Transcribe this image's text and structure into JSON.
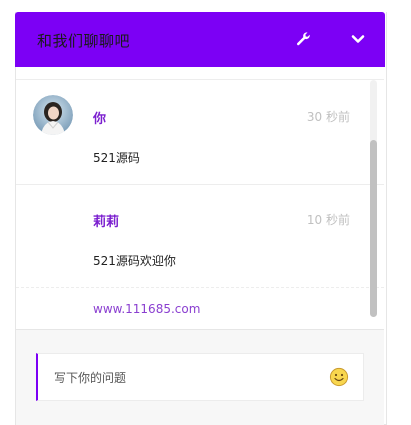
{
  "header": {
    "title": "和我们聊聊吧",
    "settings_icon": "wrench-icon",
    "collapse_icon": "chevron-down-icon",
    "background_color": "#7c00f5"
  },
  "messages": [
    {
      "name": "你",
      "time": "30 秒前",
      "text": "521源码",
      "avatar_icon": "user-avatar"
    },
    {
      "name": "莉莉",
      "time": "10 秒前",
      "text": "521源码欢迎你"
    }
  ],
  "footer_link": "www.111685.com",
  "composer": {
    "placeholder": "写下你的问题",
    "emoji_icon": "smiley-emoji-icon"
  }
}
